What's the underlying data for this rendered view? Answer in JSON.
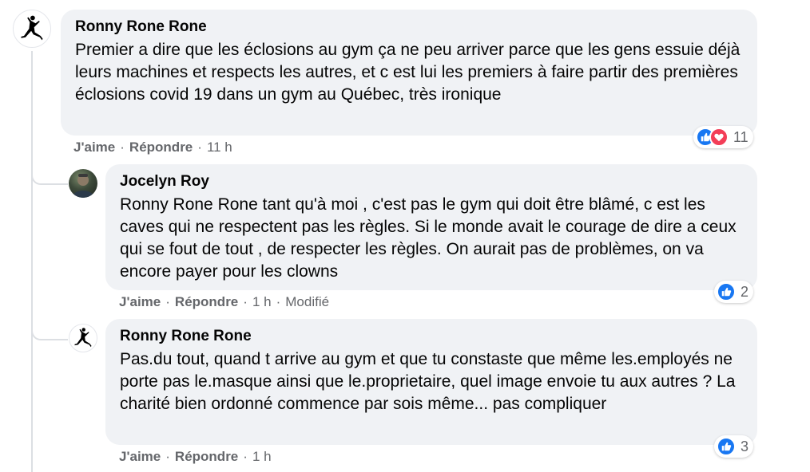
{
  "comments": [
    {
      "author": "Ronny Rone Rone",
      "text": "Premier a dire que les éclosions au gym ça ne peu arriver parce que les gens essuie déjà leurs machines et respects les autres, et c est lui les premiers à faire partir des premières éclosions covid 19 dans un gym au Québec, très ironique",
      "like_label": "J'aime",
      "reply_label": "Répondre",
      "time": "11 h",
      "reaction_count": "11"
    },
    {
      "author": "Jocelyn Roy",
      "text": "Ronny Rone Rone tant qu'à moi , c'est pas le gym qui doit être blâmé, c est les caves qui ne respectent pas les règles. Si le monde avait le courage de dire a ceux qui se fout de tout , de respecter les règles. On aurait pas de problèmes, on va encore payer pour les clowns",
      "like_label": "J'aime",
      "reply_label": "Répondre",
      "time": "1 h",
      "edited": "Modifié",
      "reaction_count": "2"
    },
    {
      "author": "Ronny Rone Rone",
      "text": "Pas.du tout, quand t arrive au gym et que tu constaste que même les.employés ne porte pas le.masque ainsi que le.proprietaire, quel image envoie tu aux autres ? La charité bien ordonné commence par sois même... pas compliquer",
      "like_label": "J'aime",
      "reply_label": "Répondre",
      "time": "1 h",
      "reaction_count": "3"
    }
  ],
  "separator": "·",
  "icons": {
    "avatar_jordan": "jumpman-logo",
    "like": "thumbs-up-icon",
    "love": "heart-icon"
  },
  "colors": {
    "like_blue": "#1877f2",
    "love_red": "#f33e58",
    "bubble_bg": "#f0f2f5",
    "meta_gray": "#65676b"
  }
}
